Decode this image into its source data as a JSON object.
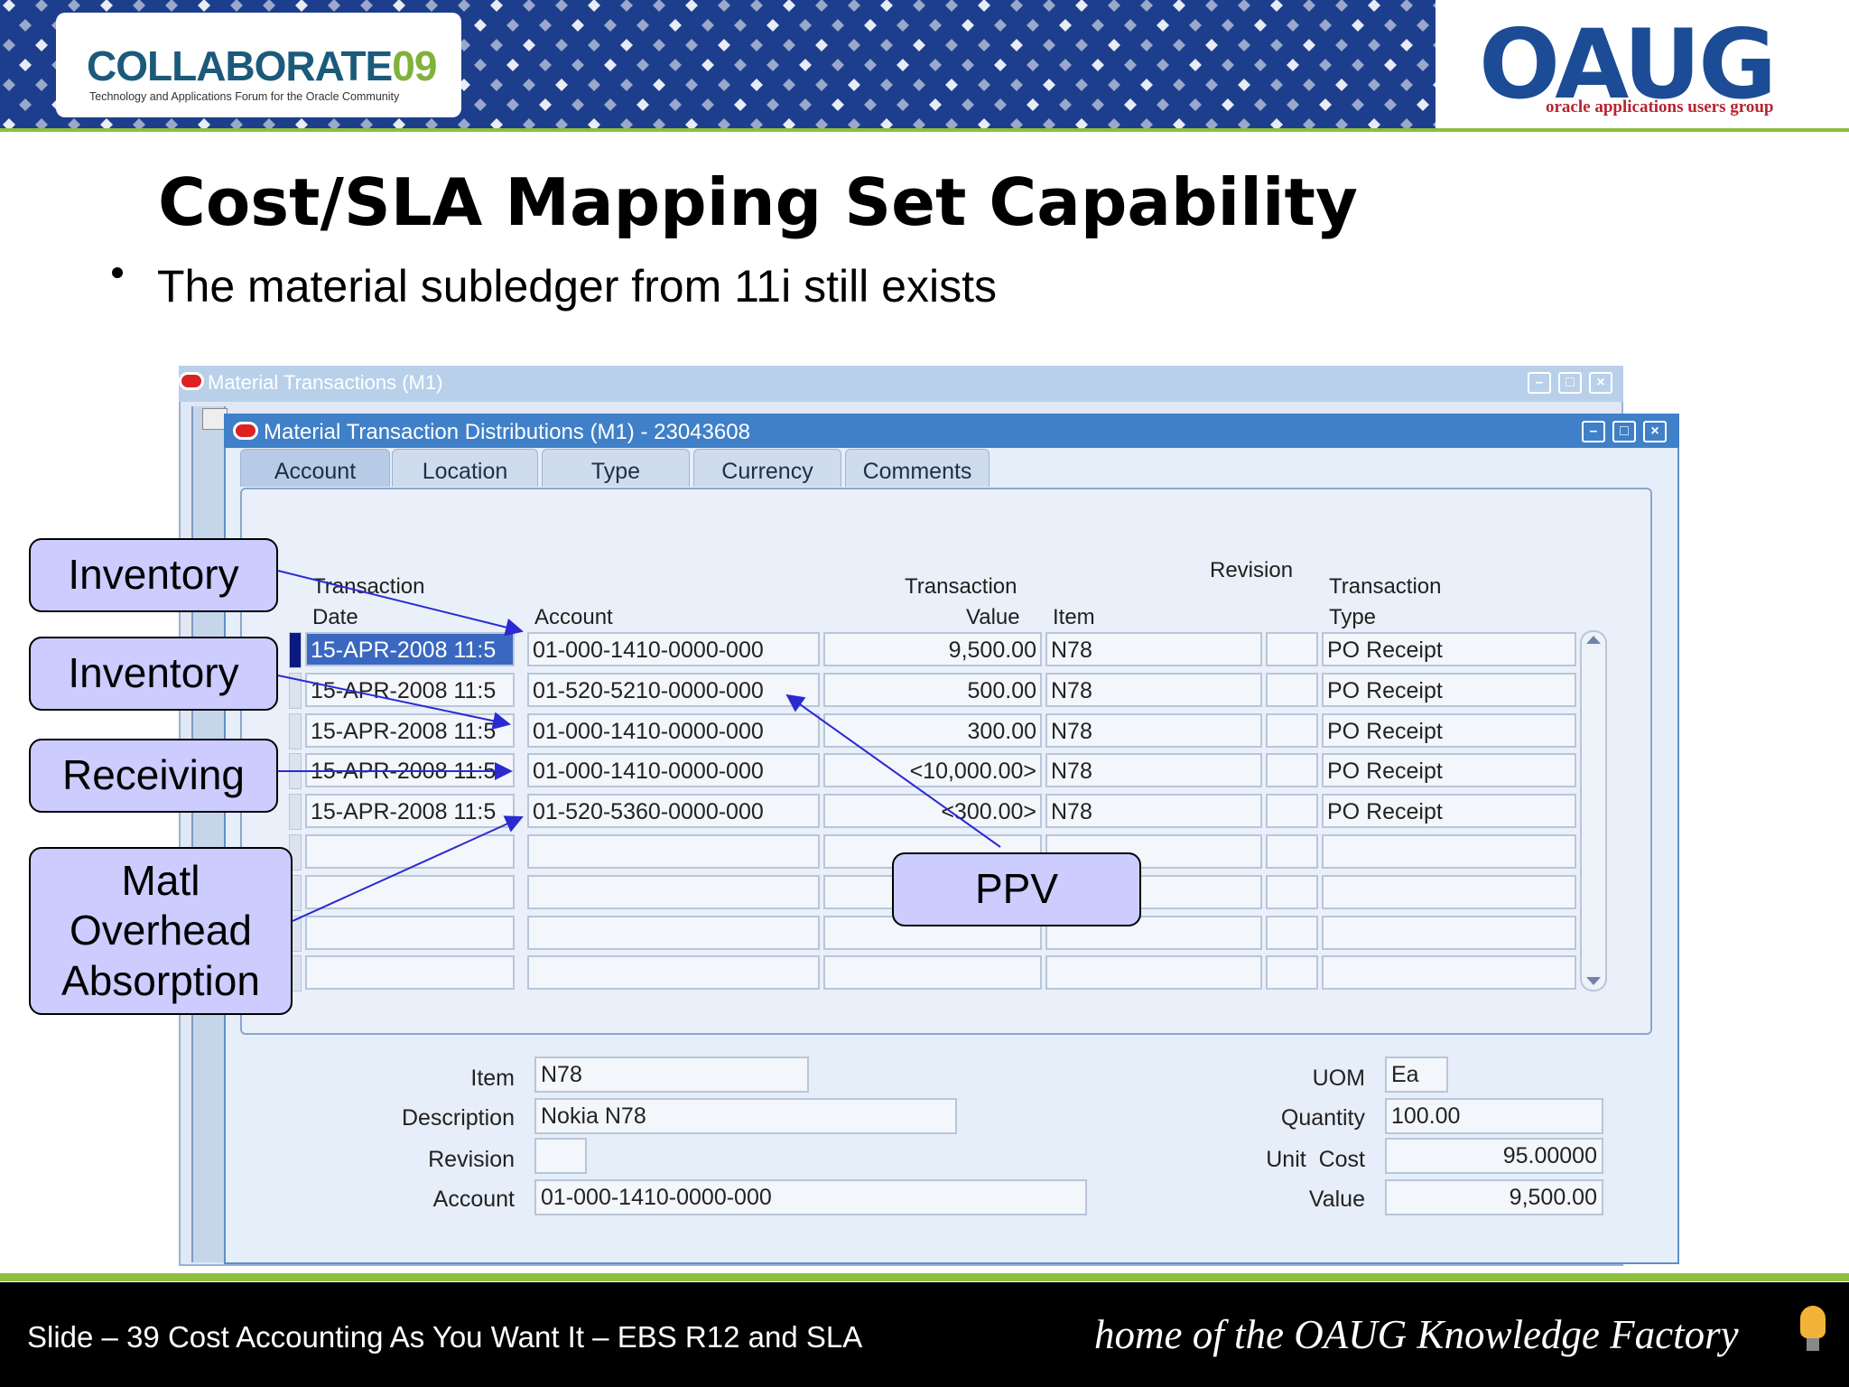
{
  "header": {
    "collaborate_logo": "COLLABORATE",
    "collaborate_year": "09",
    "collaborate_tagline": "Technology and Applications Forum for the Oracle Community",
    "oaug_logo": "OAUG",
    "oaug_tagline": "oracle applications users group"
  },
  "slide": {
    "title": "Cost/SLA Mapping Set Capability",
    "bullet": "The material subledger from 11i still exists"
  },
  "back_window": {
    "title": "Material Transactions (M1)"
  },
  "front_window": {
    "title": "Material Transaction Distributions (M1) - 23043608",
    "tabs": [
      "Account",
      "Location",
      "Type",
      "Currency",
      "Comments"
    ],
    "active_tab": "Account",
    "columns": {
      "date_line1": "Transaction",
      "date_line2": "Date",
      "account": "Account",
      "value_line1": "Transaction",
      "value_line2": "Value",
      "item": "Item",
      "revision": "Revision",
      "type_line1": "Transaction",
      "type_line2": "Type"
    },
    "rows": [
      {
        "date": "15-APR-2008 11:5",
        "account": "01-000-1410-0000-000",
        "value": "9,500.00",
        "item": "N78",
        "revision": "",
        "type": "PO Receipt"
      },
      {
        "date": "15-APR-2008 11:5",
        "account": "01-520-5210-0000-000",
        "value": "500.00",
        "item": "N78",
        "revision": "",
        "type": "PO Receipt"
      },
      {
        "date": "15-APR-2008 11:5",
        "account": "01-000-1410-0000-000",
        "value": "300.00",
        "item": "N78",
        "revision": "",
        "type": "PO Receipt"
      },
      {
        "date": "15-APR-2008 11:5",
        "account": "01-000-1410-0000-000",
        "value": "<10,000.00>",
        "item": "N78",
        "revision": "",
        "type": "PO Receipt"
      },
      {
        "date": "15-APR-2008 11:5",
        "account": "01-520-5360-0000-000",
        "value": "<300.00>",
        "item": "N78",
        "revision": "",
        "type": "PO Receipt"
      },
      {
        "date": "",
        "account": "",
        "value": "",
        "item": "",
        "revision": "",
        "type": ""
      },
      {
        "date": "",
        "account": "",
        "value": "",
        "item": "",
        "revision": "",
        "type": ""
      },
      {
        "date": "",
        "account": "",
        "value": "",
        "item": "",
        "revision": "",
        "type": ""
      },
      {
        "date": "",
        "account": "",
        "value": "",
        "item": "",
        "revision": "",
        "type": ""
      }
    ],
    "details": {
      "item_label": "Item",
      "item_value": "N78",
      "description_label": "Description",
      "description_value": "Nokia N78",
      "revision_label": "Revision",
      "revision_value": "",
      "account_label": "Account",
      "account_value": "01-000-1410-0000-000",
      "uom_label": "UOM",
      "uom_value": "Ea",
      "quantity_label": "Quantity",
      "quantity_value": "100.00",
      "unit_cost_label": "Unit  Cost",
      "unit_cost_value": "95.00000",
      "value_label": "Value",
      "value_value": "9,500.00"
    }
  },
  "callouts": {
    "inventory_1": "Inventory",
    "inventory_2": "Inventory",
    "receiving": "Receiving",
    "matl_line1": "Matl",
    "matl_line2": "Overhead",
    "matl_line3": "Absorption",
    "ppv": "PPV"
  },
  "footer": {
    "left": "Slide – 39 Cost Accounting As You Want It – EBS R12 and SLA",
    "right": "home of the OAUG Knowledge Factory"
  },
  "colors": {
    "header_blue": "#1d3e8c",
    "accent_green": "#8cbf3f",
    "window_title_blue": "#3f80c8",
    "callout_fill": "#ccccff",
    "arrow_blue": "#2a2ad0"
  }
}
